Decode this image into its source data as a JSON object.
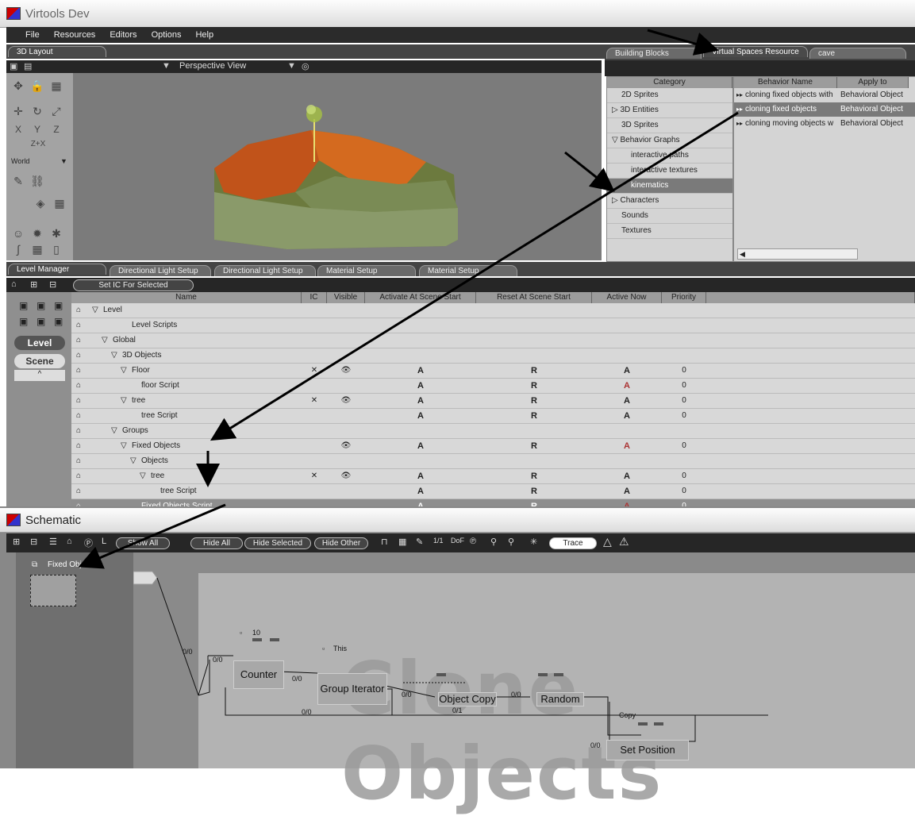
{
  "app_title": "Virtools Dev",
  "menu": [
    "File",
    "Resources",
    "Editors",
    "Options",
    "Help"
  ],
  "layout_tab": "3D Layout",
  "view_label": "Perspective View",
  "coord_mode": "World",
  "resource_tabs": [
    "Building Blocks",
    "Virtual Spaces Resource",
    "cave"
  ],
  "category_header": "Category",
  "categories": [
    {
      "label": "2D Sprites",
      "sub": false,
      "sel": false,
      "arrow": ""
    },
    {
      "label": "3D Entities",
      "sub": false,
      "sel": false,
      "arrow": "▷"
    },
    {
      "label": "3D Sprites",
      "sub": false,
      "sel": false,
      "arrow": ""
    },
    {
      "label": "Behavior Graphs",
      "sub": false,
      "sel": false,
      "arrow": "▽"
    },
    {
      "label": "interactive paths",
      "sub": true,
      "sel": false,
      "arrow": ""
    },
    {
      "label": "interactive textures",
      "sub": true,
      "sel": false,
      "arrow": ""
    },
    {
      "label": "kinematics",
      "sub": true,
      "sel": true,
      "arrow": ""
    },
    {
      "label": "Characters",
      "sub": false,
      "sel": false,
      "arrow": "▷"
    },
    {
      "label": "Sounds",
      "sub": false,
      "sel": false,
      "arrow": ""
    },
    {
      "label": "Textures",
      "sub": false,
      "sel": false,
      "arrow": ""
    }
  ],
  "behavior_headers": [
    "Behavior Name",
    "Apply to"
  ],
  "behaviors": [
    {
      "name": "cloning fixed objects with",
      "apply": "Behavioral Object",
      "sel": false
    },
    {
      "name": "cloning fixed objects",
      "apply": "Behavioral Object",
      "sel": true
    },
    {
      "name": "cloning moving objects w",
      "apply": "Behavioral Object",
      "sel": false
    }
  ],
  "level_tabs": [
    "Level Manager",
    "Directional Light Setup",
    "Directional Light Setup",
    "Material Setup",
    "Material Setup"
  ],
  "set_ic_button": "Set IC For Selected",
  "side_tabs": [
    "Level",
    "Scene"
  ],
  "lm_headers": [
    "Name",
    "IC",
    "Visible",
    "Activate At Scene Start",
    "Reset At Scene Start",
    "Active Now",
    "Priority"
  ],
  "lm_rows": [
    {
      "name": "Level",
      "indent": 0,
      "exp": "▽",
      "ic": "",
      "vis": "",
      "act": "",
      "reset": "",
      "now": "",
      "nowred": false,
      "prio": "",
      "sel": false
    },
    {
      "name": "Level Scripts",
      "indent": 3,
      "exp": "",
      "ic": "",
      "vis": "",
      "act": "",
      "reset": "",
      "now": "",
      "nowred": false,
      "prio": "",
      "sel": false
    },
    {
      "name": "Global",
      "indent": 1,
      "exp": "▽",
      "ic": "",
      "vis": "",
      "act": "",
      "reset": "",
      "now": "",
      "nowred": false,
      "prio": "",
      "sel": false
    },
    {
      "name": "3D Objects",
      "indent": 2,
      "exp": "▽",
      "ic": "",
      "vis": "",
      "act": "",
      "reset": "",
      "now": "",
      "nowred": false,
      "prio": "",
      "sel": false
    },
    {
      "name": "Floor",
      "indent": 3,
      "exp": "▽",
      "ic": "✕",
      "vis": "👁",
      "act": "A",
      "reset": "R",
      "now": "A",
      "nowred": false,
      "prio": "0",
      "sel": false
    },
    {
      "name": "floor Script",
      "indent": 4,
      "exp": "",
      "ic": "",
      "vis": "",
      "act": "A",
      "reset": "R",
      "now": "A",
      "nowred": true,
      "prio": "0",
      "sel": false
    },
    {
      "name": "tree",
      "indent": 3,
      "exp": "▽",
      "ic": "✕",
      "vis": "👁",
      "act": "A",
      "reset": "R",
      "now": "A",
      "nowred": false,
      "prio": "0",
      "sel": false
    },
    {
      "name": "tree Script",
      "indent": 4,
      "exp": "",
      "ic": "",
      "vis": "",
      "act": "A",
      "reset": "R",
      "now": "A",
      "nowred": false,
      "prio": "0",
      "sel": false
    },
    {
      "name": "Groups",
      "indent": 2,
      "exp": "▽",
      "ic": "",
      "vis": "",
      "act": "",
      "reset": "",
      "now": "",
      "nowred": false,
      "prio": "",
      "sel": false
    },
    {
      "name": "Fixed Objects",
      "indent": 3,
      "exp": "▽",
      "ic": "",
      "vis": "👁",
      "act": "A",
      "reset": "R",
      "now": "A",
      "nowred": true,
      "prio": "0",
      "sel": false
    },
    {
      "name": "Objects",
      "indent": 4,
      "exp": "▽",
      "ic": "",
      "vis": "",
      "act": "",
      "reset": "",
      "now": "",
      "nowred": false,
      "prio": "",
      "sel": false
    },
    {
      "name": "tree",
      "indent": 5,
      "exp": "▽",
      "ic": "✕",
      "vis": "👁",
      "act": "A",
      "reset": "R",
      "now": "A",
      "nowred": false,
      "prio": "0",
      "sel": false
    },
    {
      "name": "tree Script",
      "indent": 6,
      "exp": "",
      "ic": "",
      "vis": "",
      "act": "A",
      "reset": "R",
      "now": "A",
      "nowred": false,
      "prio": "0",
      "sel": false
    },
    {
      "name": "Fixed Objects Script",
      "indent": 4,
      "exp": "",
      "ic": "",
      "vis": "",
      "act": "A",
      "reset": "R",
      "now": "A",
      "nowred": true,
      "prio": "0",
      "sel": true
    }
  ],
  "schematic_title": "Schematic",
  "schematic_buttons": [
    "Show All",
    "Hide All",
    "Hide Selected",
    "Hide Other",
    "Trace"
  ],
  "fixed_objects_label": "Fixed Objects",
  "nodes": {
    "counter": "Counter",
    "group_iterator": "Group Iterator",
    "object_copy": "Object Copy",
    "random": "Random",
    "set_position": "Set Position"
  },
  "params": {
    "count": "10",
    "this": "This",
    "copy": "Copy"
  },
  "link_labels": [
    "0/0",
    "0/0",
    "0/0",
    "0/0",
    "0/0",
    "0/1",
    "0/0",
    "0/0"
  ],
  "watermark": "Clone Objects"
}
